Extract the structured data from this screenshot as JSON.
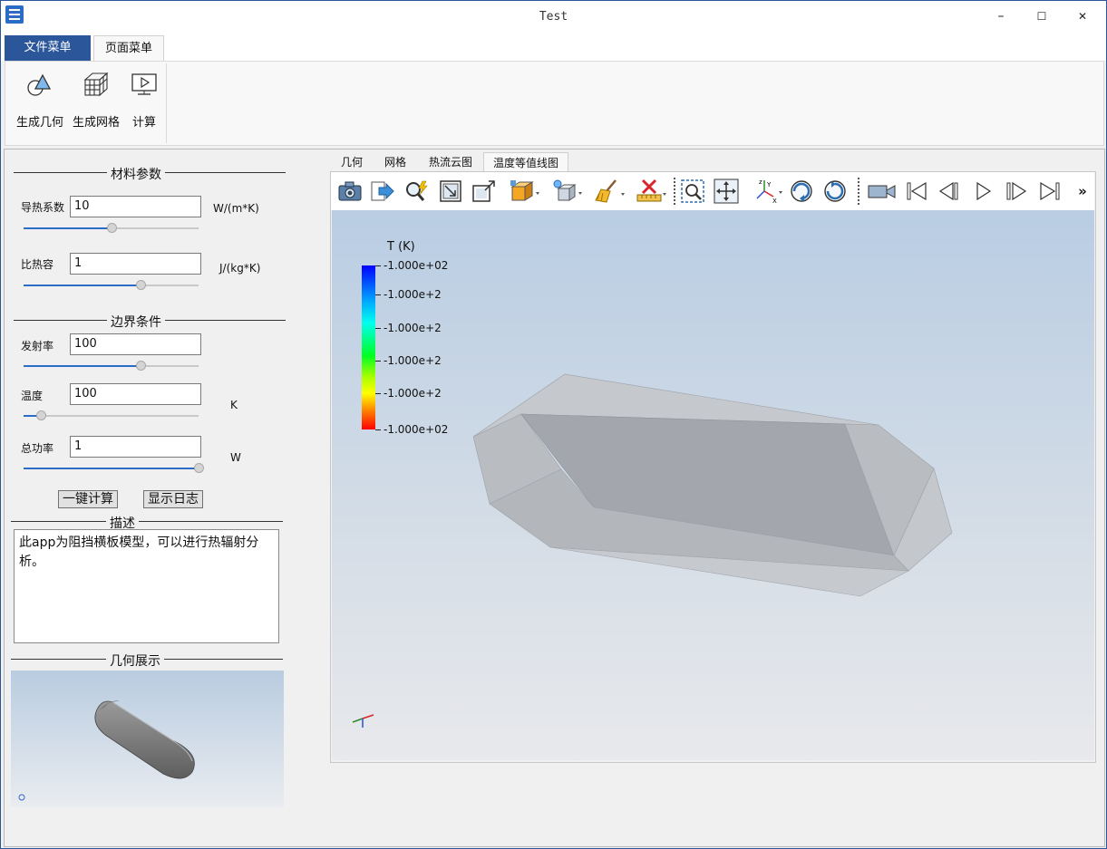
{
  "window": {
    "title": "Test",
    "minimize": "–",
    "maximize": "☐",
    "close": "✕"
  },
  "menu_tabs": [
    "文件菜单",
    "页面菜单"
  ],
  "ribbon": {
    "buttons": [
      {
        "label": "生成几何",
        "icon": "geometry-icon"
      },
      {
        "label": "生成网格",
        "icon": "mesh-icon"
      },
      {
        "label": "计算",
        "icon": "compute-icon"
      }
    ]
  },
  "left": {
    "material_section": "材料参数",
    "boundary_section": "边界条件",
    "description_section": "描述",
    "geometry_section": "几何展示",
    "fields": {
      "conductivity": {
        "label": "导热系数",
        "value": "10",
        "unit": "W/(m*K)",
        "slider": 0.5
      },
      "heat_capacity": {
        "label": "比热容",
        "value": "1",
        "unit": "J/(kg*K)",
        "slider": 0.67
      },
      "emissivity": {
        "label": "发射率",
        "value": "100",
        "unit": "",
        "slider": 0.67
      },
      "temperature": {
        "label": "温度",
        "value": "100",
        "unit": "K",
        "slider": 0.1
      },
      "total_power": {
        "label": "总功率",
        "value": "1",
        "unit": "W",
        "slider": 1.0
      }
    },
    "buttons": {
      "calculate": "一键计算",
      "show_log": "显示日志"
    },
    "description": "此app为阻挡横板模型，可以进行热辐射分析。"
  },
  "view": {
    "tabs": [
      "几何",
      "网格",
      "热流云图",
      "温度等值线图"
    ],
    "active_tab": 3,
    "toolbar_icons": [
      "camera-icon",
      "export-icon",
      "magic-zoom-icon",
      "fit-view-icon",
      "maximize-view-icon",
      "display-mode-icon",
      "light-icon",
      "clean-icon",
      "ruler-remove-icon",
      "zoom-box-icon",
      "pan-icon",
      "axes-icon",
      "rotate-cw-icon",
      "rotate-ccw-icon",
      "video-camera-icon",
      "first-frame-icon",
      "prev-frame-icon",
      "play-icon",
      "next-frame-icon",
      "last-frame-icon",
      "more-icon"
    ],
    "more_label": "»",
    "colorbar": {
      "title": "T (K)",
      "labels": [
        "-1.000e+02",
        "-1.000e+2",
        "-1.000e+2",
        "-1.000e+2",
        "-1.000e+2",
        "-1.000e+02"
      ]
    }
  }
}
